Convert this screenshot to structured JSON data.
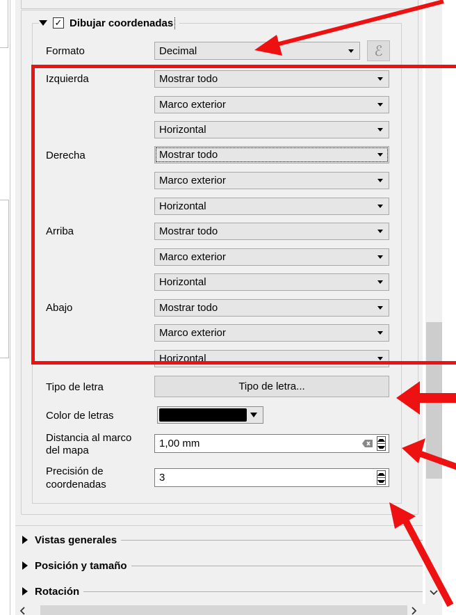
{
  "draw_coords": {
    "label": "Dibujar coordenadas",
    "checked": true
  },
  "format": {
    "label": "Formato",
    "value": "Decimal",
    "expr_icon": "epsilon-icon",
    "expr_glyph": "ℰ"
  },
  "sides": [
    {
      "label": "Izquierda",
      "display": "Mostrar todo",
      "position": "Marco exterior",
      "direction": "Horizontal"
    },
    {
      "label": "Derecha",
      "display": "Mostrar todo",
      "position": "Marco exterior",
      "direction": "Horizontal"
    },
    {
      "label": "Arriba",
      "display": "Mostrar todo",
      "position": "Marco exterior",
      "direction": "Horizontal"
    },
    {
      "label": "Abajo",
      "display": "Mostrar todo",
      "position": "Marco exterior",
      "direction": "Horizontal"
    }
  ],
  "font": {
    "label": "Tipo de letra",
    "button": "Tipo de letra..."
  },
  "font_color": {
    "label": "Color de letras",
    "color": "#000000"
  },
  "distance": {
    "label_line1": "Distancia al marco",
    "label_line2": "del mapa",
    "value": "1,00 mm"
  },
  "precision": {
    "label_line1": "Precisión de",
    "label_line2": "coordenadas",
    "value": "3"
  },
  "sections": [
    {
      "label": "Vistas generales"
    },
    {
      "label": "Posición y tamaño"
    },
    {
      "label": "Rotación"
    }
  ],
  "annotation_color": "#ee1111"
}
